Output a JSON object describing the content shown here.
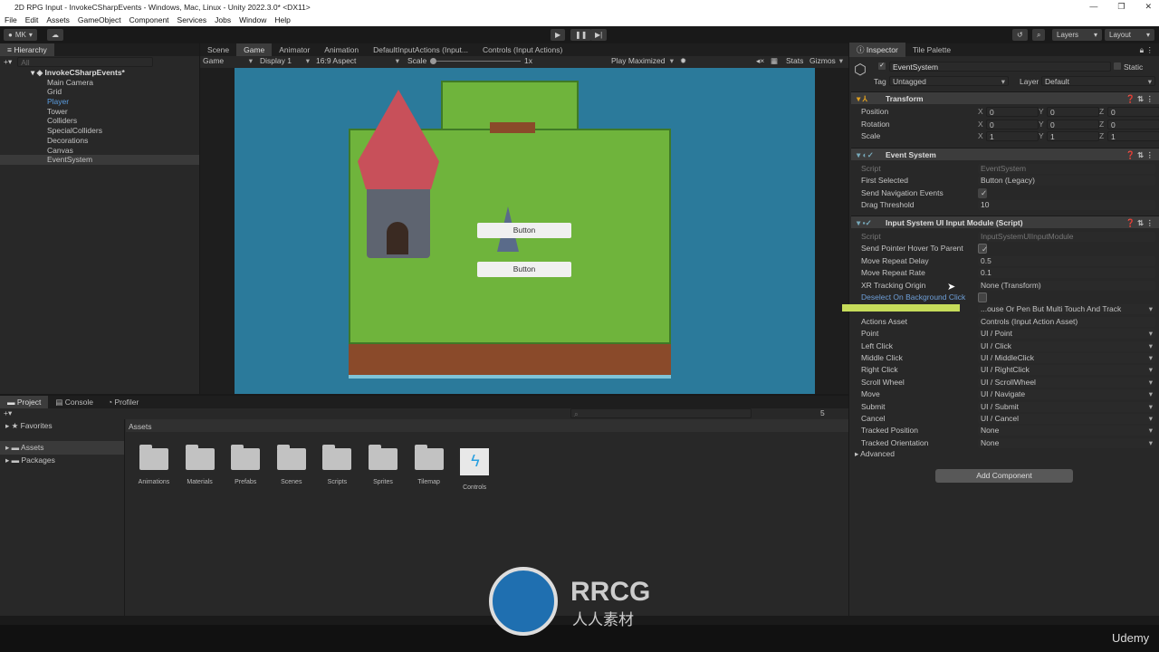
{
  "window": {
    "title": "2D RPG Input - InvokeCSharpEvents - Windows, Mac, Linux - Unity 2022.3.0* <DX11>",
    "controls": [
      "—",
      "❐",
      "✕"
    ]
  },
  "menu": [
    "File",
    "Edit",
    "Assets",
    "GameObject",
    "Component",
    "Services",
    "Jobs",
    "Window",
    "Help"
  ],
  "toolbar": {
    "account": "MK",
    "layers": "Layers",
    "layout": "Layout"
  },
  "hierarchy": {
    "title": "Hierarchy",
    "search_placeholder": "All",
    "scene": "InvokeCSharpEvents*",
    "items": [
      "Main Camera",
      "Grid",
      "Player",
      "Tower",
      "Colliders",
      "SpecialColliders",
      "Decorations",
      "Canvas",
      "EventSystem"
    ],
    "selected": "EventSystem"
  },
  "center_tabs": [
    "Scene",
    "Game",
    "Animator",
    "Animation",
    "DefaultInputActions (Input...",
    "Controls (Input Actions)"
  ],
  "game_bar": {
    "mode": "Game",
    "display": "Display 1",
    "aspect": "16:9 Aspect",
    "scale_label": "Scale",
    "scale_value": "1x",
    "play": "Play Maximized",
    "stats": "Stats",
    "gizmos": "Gizmos"
  },
  "game_view": {
    "buttons": [
      "Button",
      "Button"
    ],
    "colors": {
      "water": "#2b7a9b",
      "grass": "#6fb43c",
      "cliff": "#8a4a2a",
      "roof": "#c8505a"
    }
  },
  "inspector": {
    "tabs": [
      "Inspector",
      "Tile Palette"
    ],
    "object_name": "EventSystem",
    "static_label": "Static",
    "tag_label": "Tag",
    "tag": "Untagged",
    "layer_label": "Layer",
    "layer": "Default",
    "transform": {
      "title": "Transform",
      "rows": [
        {
          "label": "Position",
          "x": "0",
          "y": "0",
          "z": "0"
        },
        {
          "label": "Rotation",
          "x": "0",
          "y": "0",
          "z": "0"
        },
        {
          "label": "Scale",
          "x": "1",
          "y": "1",
          "z": "1"
        }
      ]
    },
    "event_system": {
      "title": "Event System",
      "rows": [
        {
          "label": "Script",
          "value": "EventSystem"
        },
        {
          "label": "First Selected",
          "value": "Button (Legacy)"
        },
        {
          "label": "Send Navigation Events",
          "value": "✓"
        },
        {
          "label": "Drag Threshold",
          "value": "10"
        }
      ]
    },
    "input_module": {
      "title": "Input System UI Input Module (Script)",
      "rows": [
        {
          "label": "Script",
          "value": "InputSystemUIInputModule"
        },
        {
          "label": "Send Pointer Hover To Parent",
          "value": "✓"
        },
        {
          "label": "Move Repeat Delay",
          "value": "0.5"
        },
        {
          "label": "Move Repeat Rate",
          "value": "0.1"
        },
        {
          "label": "XR Tracking Origin",
          "value": "None (Transform)"
        },
        {
          "label": "Deselect On Background Click",
          "value": ""
        },
        {
          "label": "",
          "value": "...ouse Or Pen But Multi Touch And Track"
        },
        {
          "label": "Actions Asset",
          "value": "Controls (Input Action Asset)"
        },
        {
          "label": "Point",
          "value": "UI / Point"
        },
        {
          "label": "Left Click",
          "value": "UI / Click"
        },
        {
          "label": "Middle Click",
          "value": "UI / MiddleClick"
        },
        {
          "label": "Right Click",
          "value": "UI / RightClick"
        },
        {
          "label": "Scroll Wheel",
          "value": "UI / ScrollWheel"
        },
        {
          "label": "Move",
          "value": "UI / Navigate"
        },
        {
          "label": "Submit",
          "value": "UI / Submit"
        },
        {
          "label": "Cancel",
          "value": "UI / Cancel"
        },
        {
          "label": "Tracked Position",
          "value": "None"
        },
        {
          "label": "Tracked Orientation",
          "value": "None"
        }
      ],
      "advanced": "Advanced"
    },
    "add_component": "Add Component"
  },
  "project": {
    "tabs": [
      "Project",
      "Console",
      "Profiler"
    ],
    "tree": [
      "Favorites",
      "Assets",
      "Packages"
    ],
    "breadcrumb": "Assets",
    "hidden_count": "5",
    "assets": [
      "Animations",
      "Materials",
      "Prefabs",
      "Scenes",
      "Scripts",
      "Sprites",
      "Tilemap",
      "Controls"
    ]
  },
  "watermark": {
    "logo": "RRCG",
    "sub": "人人素材"
  },
  "udemy": "Udemy"
}
